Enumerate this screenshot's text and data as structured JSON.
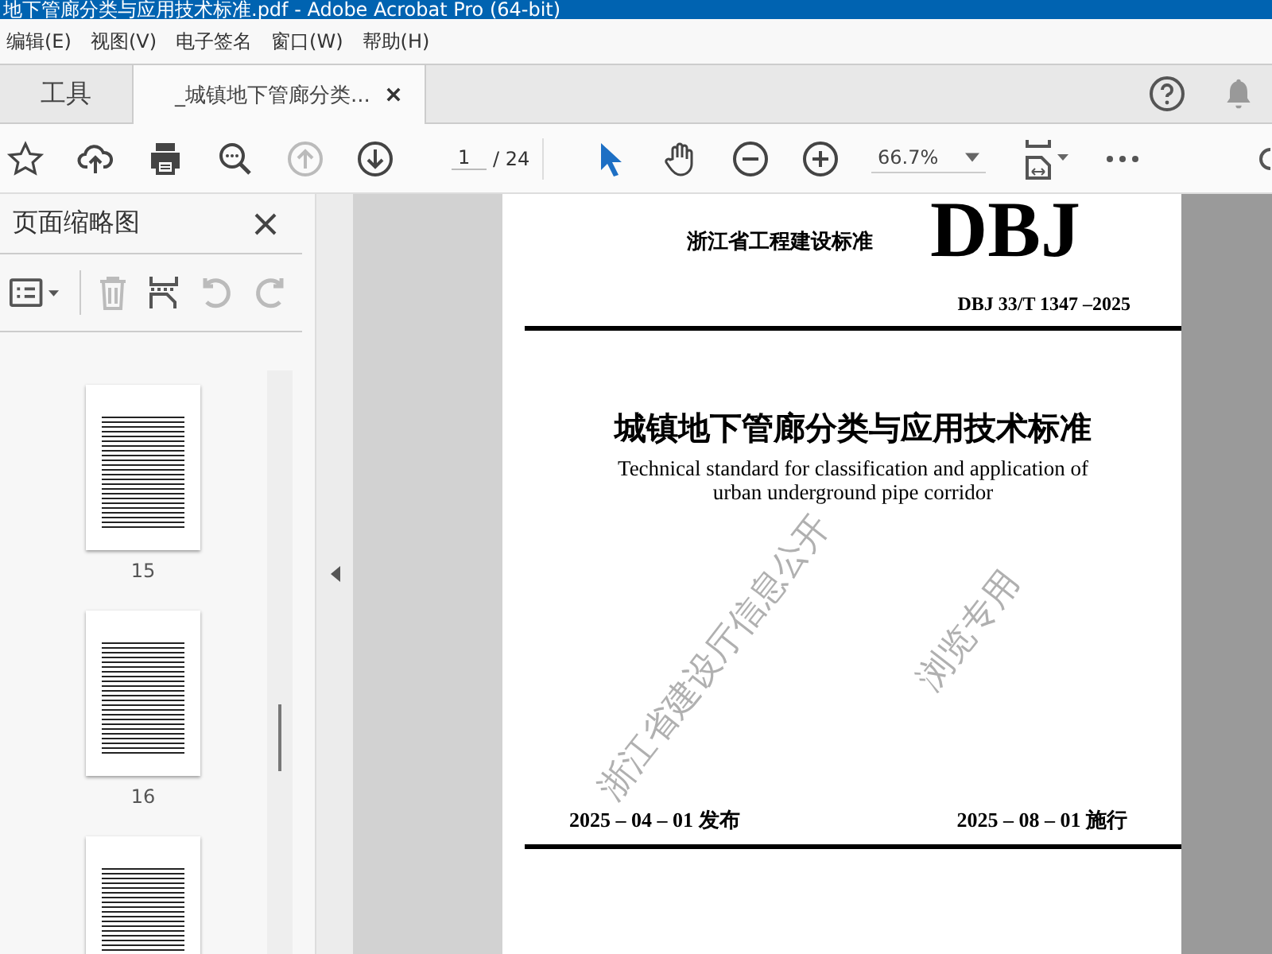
{
  "window": {
    "title": "地下管廊分类与应用技术标准.pdf - Adobe Acrobat Pro (64-bit)"
  },
  "menu": [
    "编辑(E)",
    "视图(V)",
    "电子签名",
    "窗口(W)",
    "帮助(H)"
  ],
  "tabs": [
    {
      "label": "工具",
      "selected": false,
      "closable": false
    },
    {
      "label": "_城镇地下管廊分类...",
      "selected": true,
      "closable": true
    }
  ],
  "toolbar": {
    "page": "1",
    "page_total": "/ 24",
    "zoom": "66.7%"
  },
  "sidebar": {
    "title": "页面缩略图",
    "thumbnails": [
      {
        "kind": "full",
        "label": "15"
      },
      {
        "kind": "full",
        "label": "16"
      },
      {
        "kind": "cut"
      }
    ]
  },
  "document": {
    "issuer": "浙江省工程建设标准",
    "logo": "DBJ",
    "code": "DBJ 33/T 1347 –2025",
    "title": "城镇地下管廊分类与应用技术标准",
    "subtitle_lines": [
      "Technical standard for classification and application of",
      "urban underground pipe corridor"
    ],
    "watermarks": [
      "浙江省建设厅信息公开",
      "浏览专用"
    ],
    "issued": "2025 – 04 – 01 发布",
    "effective": "2025 – 08 – 01 施行"
  }
}
